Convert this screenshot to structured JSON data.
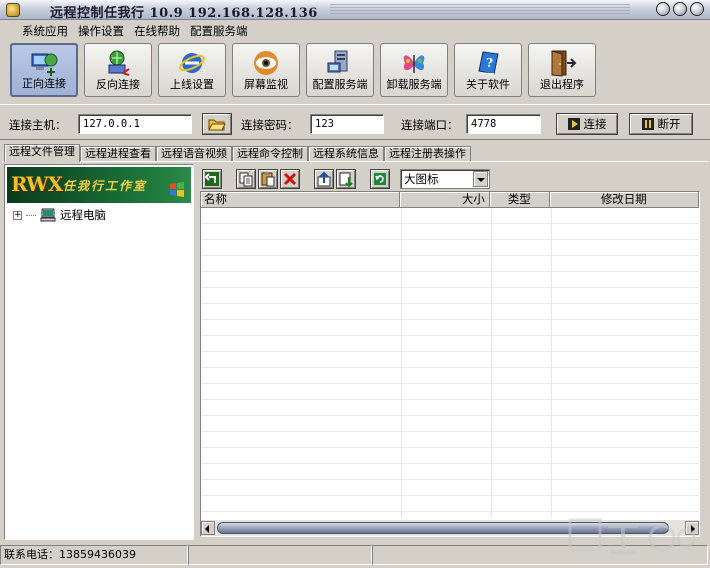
{
  "window": {
    "title": "远程控制任我行  10.9   192.168.128.136"
  },
  "menu": [
    "系统应用",
    "操作设置",
    "在线帮助",
    "配置服务端"
  ],
  "toolbar": [
    {
      "label": "正向连接",
      "icon": "network-forward-icon",
      "active": true
    },
    {
      "label": "反向连接",
      "icon": "network-reverse-icon",
      "active": false
    },
    {
      "label": "上线设置",
      "icon": "ie-globe-icon",
      "active": false
    },
    {
      "label": "屏幕监视",
      "icon": "eye-icon",
      "active": false
    },
    {
      "label": "配置服务端",
      "icon": "server-config-icon",
      "active": false
    },
    {
      "label": "卸载服务端",
      "icon": "butterfly-icon",
      "active": false
    },
    {
      "label": "关于软件",
      "icon": "help-book-icon",
      "active": false
    },
    {
      "label": "退出程序",
      "icon": "exit-door-icon",
      "active": false
    }
  ],
  "connection": {
    "host_label": "连接主机：",
    "host_value": "127.0.0.1",
    "password_label": "连接密码：",
    "password_value": "123",
    "port_label": "连接端口：",
    "port_value": "4778",
    "connect_label": "连接",
    "disconnect_label": "断开"
  },
  "tabs": [
    "远程文件管理",
    "远程进程查看",
    "远程语音视频",
    "远程命令控制",
    "远程系统信息",
    "远程注册表操作"
  ],
  "left_panel": {
    "banner_logo": "RWX",
    "banner_text": "任我行工作室",
    "tree_root": "远程电脑"
  },
  "file_toolbar": {
    "view_mode": "大图标"
  },
  "file_list": {
    "columns": [
      "名称",
      "大小",
      "类型",
      "修改日期"
    ],
    "rows": []
  },
  "status": {
    "phone": "联系电话：13859436039"
  },
  "colors": {
    "window_bg": "#d4d0c8",
    "banner_green": "#135a2e",
    "banner_gold": "#f2c020"
  }
}
